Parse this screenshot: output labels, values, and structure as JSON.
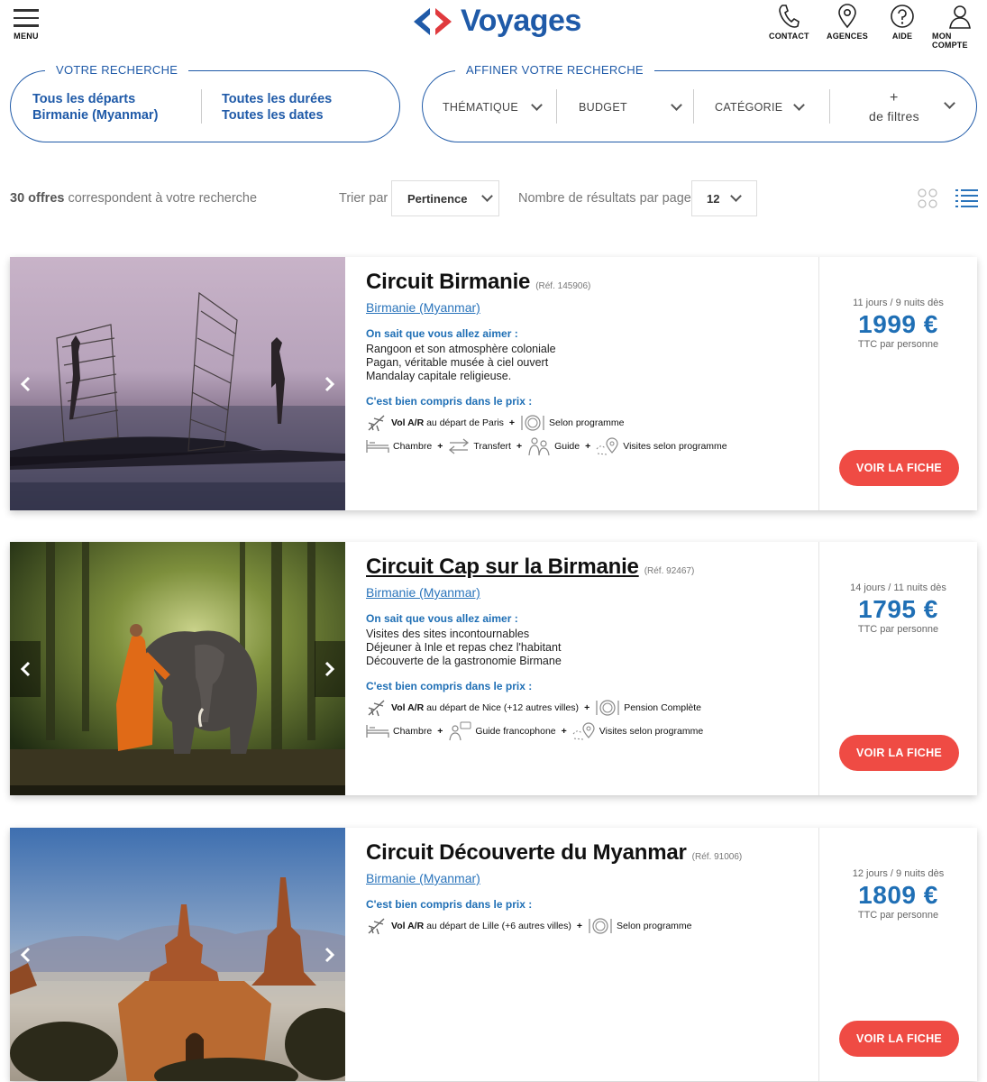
{
  "header": {
    "menu_label": "MENU",
    "logo_text": "Voyages",
    "nav": [
      {
        "label": "CONTACT",
        "icon": "phone-icon"
      },
      {
        "label": "AGENCES",
        "icon": "map-pin-icon"
      },
      {
        "label": "AIDE",
        "icon": "help-icon"
      },
      {
        "label": "MON COMPTE",
        "icon": "user-icon"
      }
    ]
  },
  "search": {
    "title": "VOTRE RECHERCHE",
    "col1_line1": "Tous les départs",
    "col1_line2": "Birmanie (Myanmar)",
    "col2_line1": "Toutes les durées",
    "col2_line2": "Toutes les dates"
  },
  "refine": {
    "title": "AFFINER VOTRE RECHERCHE",
    "filters": [
      "THÉMATIQUE",
      "BUDGET",
      "CATÉGORIE"
    ],
    "more_plus": "+",
    "more_label": "de filtres"
  },
  "results": {
    "count": "30 offres",
    "count_suffix": "correspondent à votre recherche",
    "sort_label": "Trier par",
    "sort_value": "Pertinence",
    "per_page_label": "Nombre de résultats par page",
    "per_page_value": "12"
  },
  "offers": [
    {
      "title": "Circuit Birmanie",
      "ref": "(Réf. 145906)",
      "location": "Birmanie (Myanmar)",
      "highlights_title": "On sait que vous allez aimer :",
      "highlights": [
        "Rangoon et son atmosphère coloniale",
        "Pagan, véritable musée à ciel ouvert",
        "Mandalay capitale religieuse."
      ],
      "included_title": "C'est bien compris dans le prix :",
      "flight_bold": "Vol A/R",
      "flight_rest": "au départ de Paris",
      "meal": "Selon programme",
      "room": "Chambre",
      "transfer": "Transfert",
      "guide": "Guide",
      "visits": "Visites selon programme",
      "duration": "11 jours / 9 nuits dès",
      "price": "1999 €",
      "price_note": "TTC par personne",
      "cta": "VOIR LA FICHE"
    },
    {
      "title": "Circuit Cap sur la Birmanie",
      "ref": "(Réf. 92467)",
      "location": "Birmanie (Myanmar)",
      "highlights_title": "On sait que vous allez aimer :",
      "highlights": [
        "Visites des sites incontournables",
        "Déjeuner à Inle et repas chez l'habitant",
        "Découverte de la gastronomie Birmane"
      ],
      "included_title": "C'est bien compris dans le prix :",
      "flight_bold": "Vol A/R",
      "flight_rest": "au départ de Nice (+12 autres villes)",
      "meal": "Pension Complète",
      "room": "Chambre",
      "guide": "Guide francophone",
      "visits": "Visites selon programme",
      "duration": "14 jours / 11 nuits dès",
      "price": "1795 €",
      "price_note": "TTC par personne",
      "cta": "VOIR LA FICHE"
    },
    {
      "title": "Circuit Découverte du Myanmar",
      "ref": "(Réf. 91006)",
      "location": "Birmanie (Myanmar)",
      "included_title": "C'est bien compris dans le prix :",
      "flight_bold": "Vol A/R",
      "flight_rest": "au départ de Lille (+6 autres villes)",
      "meal": "Selon programme",
      "duration": "12 jours / 9 nuits dès",
      "price": "1809 €",
      "price_note": "TTC par personne",
      "cta": "VOIR LA FICHE"
    }
  ],
  "colors": {
    "brand_blue": "#1f5aa8",
    "link_blue": "#2a74bb",
    "cta_red": "#ef4b44"
  }
}
